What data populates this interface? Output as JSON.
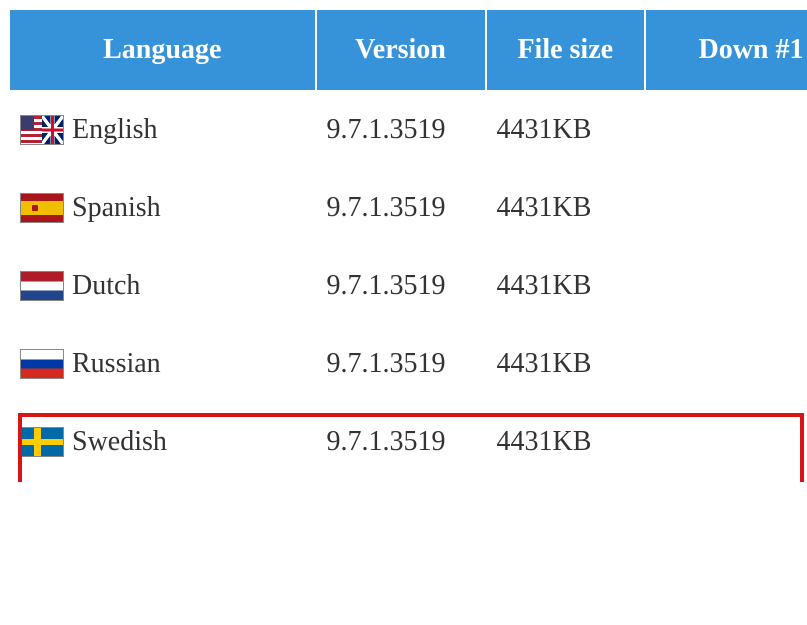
{
  "headers": {
    "language": "Language",
    "version": "Version",
    "file_size": "File size",
    "download": "Down #1"
  },
  "rows": [
    {
      "flag": "english",
      "language": "English",
      "version": "9.7.1.3519",
      "file_size": "4431KB",
      "highlighted": false
    },
    {
      "flag": "spanish",
      "language": "Spanish",
      "version": "9.7.1.3519",
      "file_size": "4431KB",
      "highlighted": false
    },
    {
      "flag": "dutch",
      "language": "Dutch",
      "version": "9.7.1.3519",
      "file_size": "4431KB",
      "highlighted": false
    },
    {
      "flag": "russian",
      "language": "Russian",
      "version": "9.7.1.3519",
      "file_size": "4431KB",
      "highlighted": true
    },
    {
      "flag": "swedish",
      "language": "Swedish",
      "version": "9.7.1.3519",
      "file_size": "4431KB",
      "highlighted": false
    }
  ]
}
